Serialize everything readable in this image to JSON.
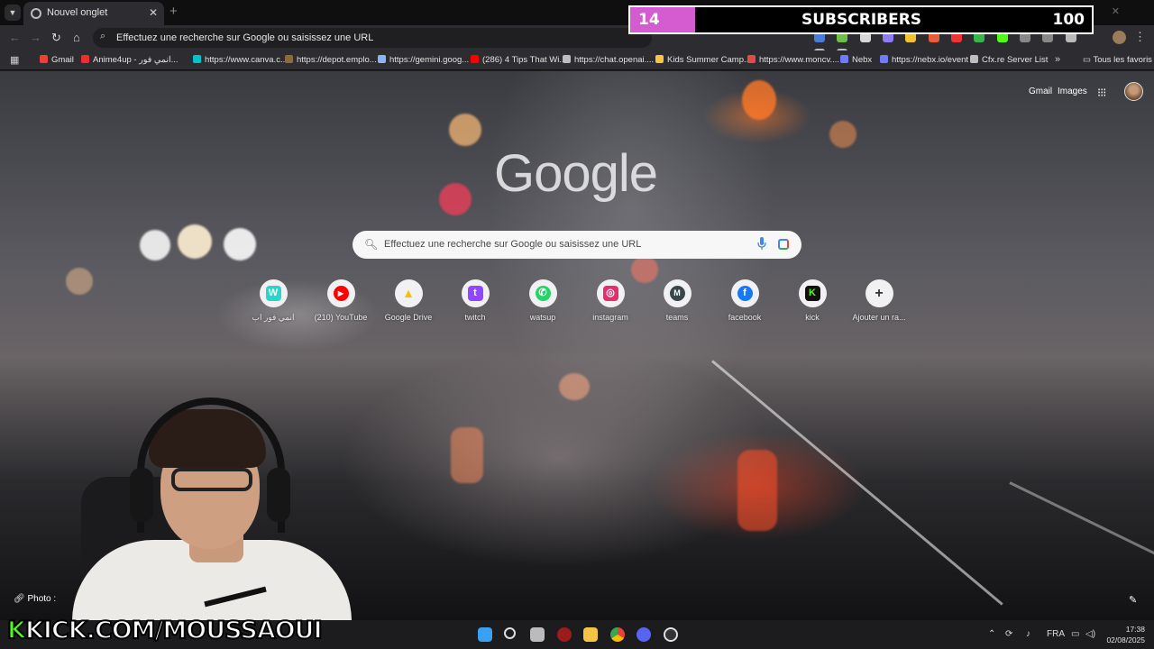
{
  "browser": {
    "tab_title": "Nouvel onglet",
    "omnibox_text": "Effectuez une recherche sur Google ou saisissez une URL"
  },
  "bookmarks": [
    {
      "label": "Gmail",
      "color": "#ea4335"
    },
    {
      "label": "Anime4up - انمي فور...",
      "color": "#f02c2c"
    },
    {
      "label": "https://www.canva.c...",
      "color": "#00c4cc"
    },
    {
      "label": "https://depot.emplo...",
      "color": "#8a6d3b"
    },
    {
      "label": "https://gemini.goog...",
      "color": "#8ab4f8"
    },
    {
      "label": "(286) 4 Tips That Wi...",
      "color": "#ff0000"
    },
    {
      "label": "https://chat.openai....",
      "color": "#bdbdbd"
    },
    {
      "label": "Kids Summer Camp...",
      "color": "#f6c342"
    },
    {
      "label": "https://www.moncv....",
      "color": "#e24a4a"
    },
    {
      "label": "Nebx",
      "color": "#6f7bf7"
    },
    {
      "label": "https://nebx.io/event",
      "color": "#6f7bf7"
    },
    {
      "label": "Cfx.re Server List",
      "color": "#bdbdbd"
    }
  ],
  "bookmarks_all": "Tous les favoris",
  "sub_counter": {
    "current": "14",
    "label": "SUBSCRIBERS",
    "goal": "100",
    "progress": 0.14,
    "color": "#d55bd0"
  },
  "newtab": {
    "gmail": "Gmail",
    "images": "Images",
    "logo": "Google",
    "search_placeholder": "Effectuez une recherche sur Google ou saisissez une URL",
    "photo_credit": "Photo :"
  },
  "shortcuts": [
    {
      "label": "انمي فور اب",
      "glyph": "W",
      "color": "#2cd4c8"
    },
    {
      "label": "(210) YouTube",
      "glyph": "▶",
      "color": "#ff0000"
    },
    {
      "label": "Google Drive",
      "glyph": "▲",
      "color": "#34a853"
    },
    {
      "label": "twitch",
      "glyph": "t",
      "color": "#9146ff"
    },
    {
      "label": "watsup",
      "glyph": "✆",
      "color": "#25d366"
    },
    {
      "label": "instagram",
      "glyph": "◎",
      "color": "#e1306c"
    },
    {
      "label": "teams",
      "glyph": "M",
      "color": "#37474f"
    },
    {
      "label": "facebook",
      "glyph": "f",
      "color": "#1877f2"
    },
    {
      "label": "kick",
      "glyph": "K",
      "color": "#53fc18"
    },
    {
      "label": "Ajouter un ra...",
      "glyph": "+",
      "color": "#f1f1f3"
    }
  ],
  "overlay_text": {
    "k": "K",
    "rest": "KICK.COM/MOUSSAOUI"
  },
  "taskbar": {
    "lang": "FRA",
    "time": "17:38",
    "date": "02/08/2025",
    "icons": [
      "start-icon",
      "search-icon",
      "task-view-icon",
      "app-red-icon",
      "explorer-icon",
      "chrome-icon",
      "discord-icon",
      "obs-icon"
    ]
  }
}
